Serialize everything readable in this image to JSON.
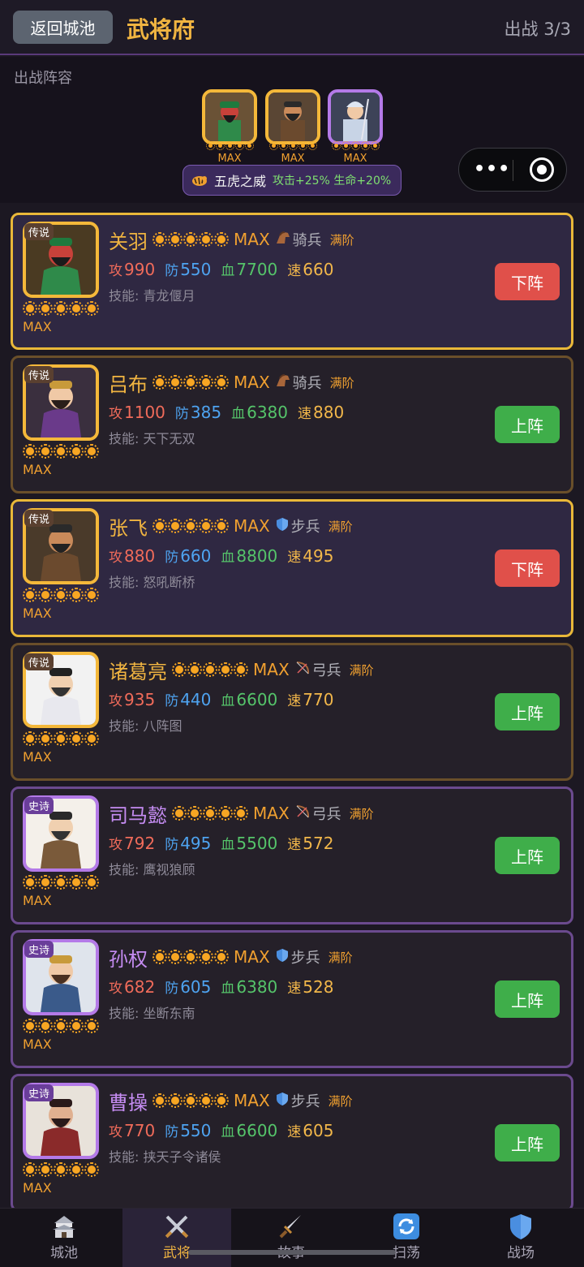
{
  "header": {
    "back_label": "返回城池",
    "title": "武将府",
    "deploy_status": "出战 3/3"
  },
  "lineup": {
    "label": "出战阵容",
    "slots": [
      {
        "hero": "关羽",
        "rarity": "legend",
        "max": "MAX"
      },
      {
        "hero": "张飞",
        "rarity": "legend",
        "max": "MAX"
      },
      {
        "hero": "赵云",
        "rarity": "epic",
        "max": "MAX"
      }
    ],
    "bond": {
      "icon": "tiger-icon",
      "name": "五虎之威",
      "effect": "攻击+25% 生命+20%"
    }
  },
  "generals": [
    {
      "rarity_label": "传说",
      "name": "关羽",
      "max": "MAX",
      "troop_icon": "horse-icon",
      "troop": "骑兵",
      "full": "满阶",
      "atk_label": "攻",
      "atk": "990",
      "def_label": "防",
      "def": "550",
      "hp_label": "血",
      "hp": "7700",
      "spd_label": "速",
      "spd": "660",
      "skill": "技能: 青龙偃月",
      "button": "下阵"
    },
    {
      "rarity_label": "传说",
      "name": "吕布",
      "max": "MAX",
      "troop_icon": "horse-icon",
      "troop": "骑兵",
      "full": "满阶",
      "atk_label": "攻",
      "atk": "1100",
      "def_label": "防",
      "def": "385",
      "hp_label": "血",
      "hp": "6380",
      "spd_label": "速",
      "spd": "880",
      "skill": "技能: 天下无双",
      "button": "上阵"
    },
    {
      "rarity_label": "传说",
      "name": "张飞",
      "max": "MAX",
      "troop_icon": "shield-icon",
      "troop": "步兵",
      "full": "满阶",
      "atk_label": "攻",
      "atk": "880",
      "def_label": "防",
      "def": "660",
      "hp_label": "血",
      "hp": "8800",
      "spd_label": "速",
      "spd": "495",
      "skill": "技能: 怒吼断桥",
      "button": "下阵"
    },
    {
      "rarity_label": "传说",
      "name": "诸葛亮",
      "max": "MAX",
      "troop_icon": "bow-icon",
      "troop": "弓兵",
      "full": "满阶",
      "atk_label": "攻",
      "atk": "935",
      "def_label": "防",
      "def": "440",
      "hp_label": "血",
      "hp": "6600",
      "spd_label": "速",
      "spd": "770",
      "skill": "技能: 八阵图",
      "button": "上阵"
    },
    {
      "rarity_label": "史诗",
      "name": "司马懿",
      "max": "MAX",
      "troop_icon": "bow-icon",
      "troop": "弓兵",
      "full": "满阶",
      "atk_label": "攻",
      "atk": "792",
      "def_label": "防",
      "def": "495",
      "hp_label": "血",
      "hp": "5500",
      "spd_label": "速",
      "spd": "572",
      "skill": "技能: 鹰视狼顾",
      "button": "上阵"
    },
    {
      "rarity_label": "史诗",
      "name": "孙权",
      "max": "MAX",
      "troop_icon": "shield-icon",
      "troop": "步兵",
      "full": "满阶",
      "atk_label": "攻",
      "atk": "682",
      "def_label": "防",
      "def": "605",
      "hp_label": "血",
      "hp": "6380",
      "spd_label": "速",
      "spd": "528",
      "skill": "技能: 坐断东南",
      "button": "上阵"
    },
    {
      "rarity_label": "史诗",
      "name": "曹操",
      "max": "MAX",
      "troop_icon": "shield-icon",
      "troop": "步兵",
      "full": "满阶",
      "atk_label": "攻",
      "atk": "770",
      "def_label": "防",
      "def": "550",
      "hp_label": "血",
      "hp": "6600",
      "spd_label": "速",
      "spd": "605",
      "skill": "技能: 挟天子令诸侯",
      "button": "上阵"
    }
  ],
  "tabs": [
    {
      "label": "城池",
      "icon": "castle-icon"
    },
    {
      "label": "武将",
      "icon": "crossed-swords-icon",
      "active": true
    },
    {
      "label": "故事",
      "icon": "dagger-icon"
    },
    {
      "label": "扫荡",
      "icon": "refresh-icon"
    },
    {
      "label": "战场",
      "icon": "shield-icon"
    }
  ],
  "colors": {
    "accent_gold": "#f0b441",
    "epic_purple": "#c58cf2",
    "deploy_red": "#e0504a",
    "deploy_green": "#3fae4a"
  }
}
